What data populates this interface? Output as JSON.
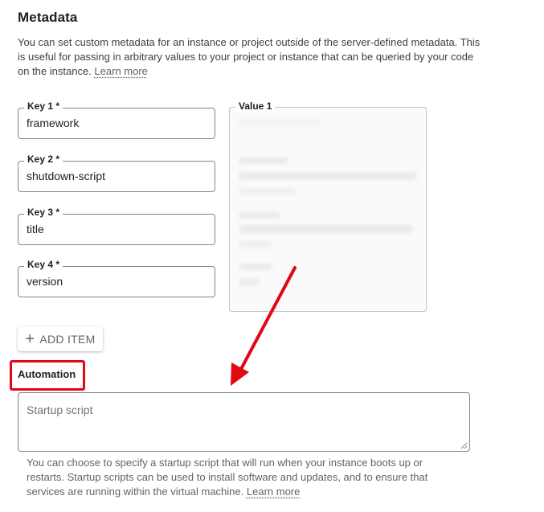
{
  "section": {
    "title": "Metadata",
    "description": "You can set custom metadata for an instance or project outside of the server-defined metadata. This is useful for passing in arbitrary values to your project or instance that can be queried by your code on the instance.",
    "learn_more": "Learn more"
  },
  "metadata_items": [
    {
      "key_label": "Key 1 *",
      "key_value": "framework"
    },
    {
      "key_label": "Key 2 *",
      "key_value": "shutdown-script"
    },
    {
      "key_label": "Key 3 *",
      "key_value": "title"
    },
    {
      "key_label": "Key 4 *",
      "key_value": "version"
    }
  ],
  "value_label": "Value 1",
  "add_item": {
    "icon": "plus-icon",
    "label": "ADD ITEM"
  },
  "automation": {
    "title": "Automation",
    "placeholder": "Startup script",
    "help": "You can choose to specify a startup script that will run when your instance boots up or restarts. Startup scripts can be used to install software and updates, and to ensure that services are running within the virtual machine.",
    "learn_more": "Learn more"
  },
  "annotation": {
    "highlight_color": "#e30613",
    "arrow_color": "#e30613"
  }
}
